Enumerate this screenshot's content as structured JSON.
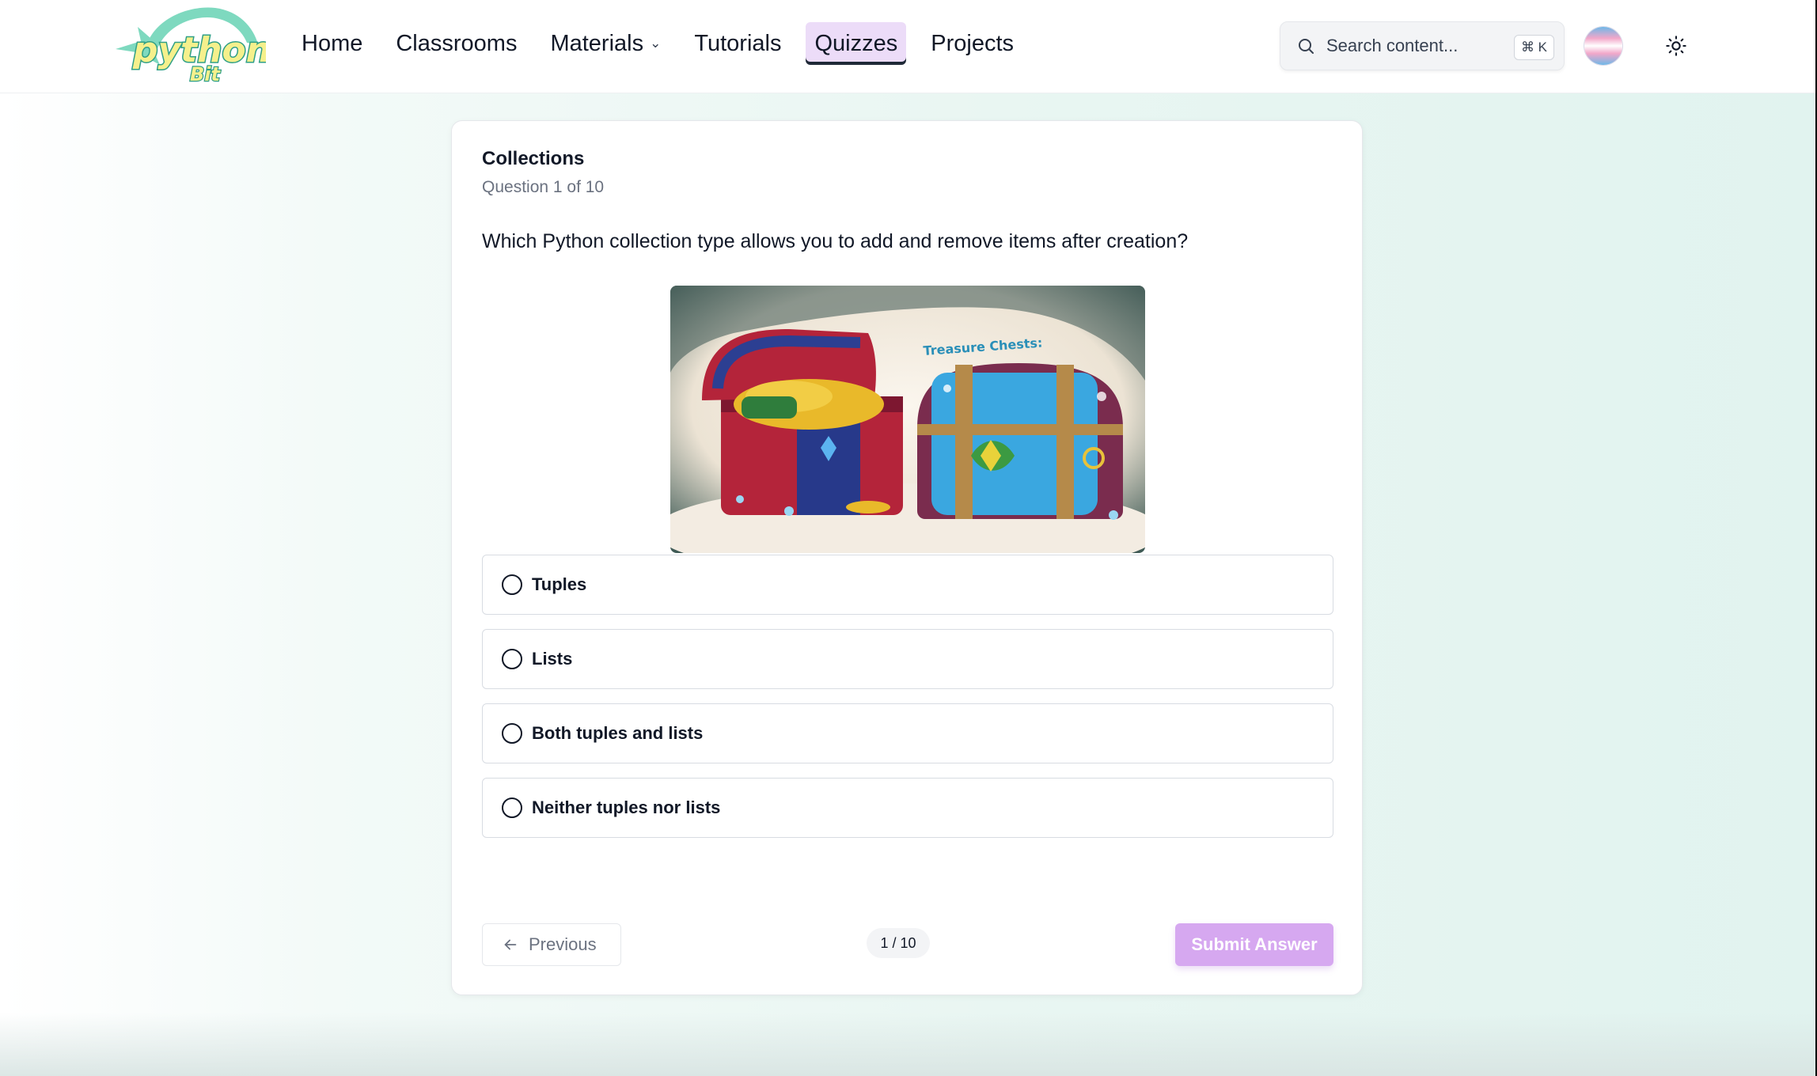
{
  "header": {
    "logo_text": "python",
    "logo_subtext": "Bit",
    "nav": [
      {
        "label": "Home"
      },
      {
        "label": "Classrooms"
      },
      {
        "label": "Materials"
      },
      {
        "label": "Tutorials"
      },
      {
        "label": "Quizzes",
        "active": true
      },
      {
        "label": "Projects"
      }
    ],
    "search": {
      "placeholder": "Search content...",
      "shortcut": "⌘ K"
    },
    "icons": {
      "search": "search-icon",
      "theme": "sun-icon",
      "materials_dropdown": "chevron-down-icon"
    }
  },
  "quiz": {
    "title": "Collections",
    "progress_text": "Question 1 of 10",
    "question": "Which Python collection type allows you to add and remove items after creation?",
    "illustration_caption": "Treasure Chests:",
    "options": [
      {
        "label": "Tuples"
      },
      {
        "label": "Lists"
      },
      {
        "label": "Both tuples and lists"
      },
      {
        "label": "Neither tuples nor lists"
      }
    ],
    "footer": {
      "previous_label": "Previous",
      "page_indicator": "1 / 10",
      "submit_label": "Submit Answer"
    }
  },
  "colors": {
    "accent": "#d6a8f0",
    "active_nav_bg": "#ecdcf8",
    "logo_green": "#6fd3b4",
    "logo_yellow": "#f5f08c"
  }
}
